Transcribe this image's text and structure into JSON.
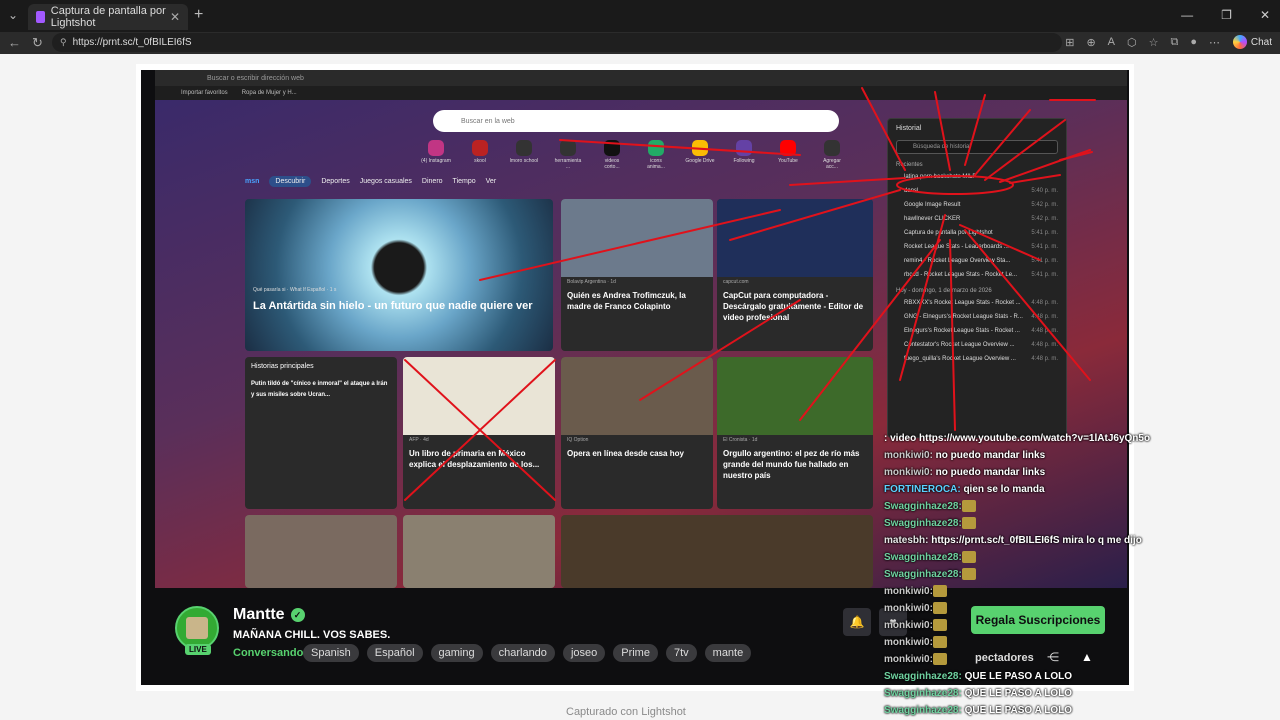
{
  "browser": {
    "tab_title": "Captura de pantalla por Lightshot",
    "url": "https://prnt.sc/t_0fBILEI6fS",
    "copilot_label": "Chat"
  },
  "inner_browser": {
    "address_placeholder": "Buscar o escribir dirección web",
    "favorites": [
      "Importar favoritos",
      "Ropa de Mujer y H..."
    ],
    "search_placeholder": "Buscar en la web",
    "quick_links": [
      "(4) Instagram",
      "skool",
      "lmoro school",
      "herramienta ...",
      "videos corto...",
      "icons anima...",
      "Google Drive",
      "Following",
      "YouTube",
      "Agregar acc..."
    ],
    "msn_nav": [
      "Descubrir",
      "Deportes",
      "Juegos casuales",
      "Dinero",
      "Tiempo",
      "Ver"
    ],
    "hero_source": "Qué pasaría si · What If Español · 1 s",
    "hero_title": "La Antártida sin hielo - un futuro que nadie quiere ver",
    "cards": [
      {
        "source": "Bolavip Argentina · 1d",
        "title": "Quién es Andrea Trofimczuk, la madre de Franco Colapinto"
      },
      {
        "source": "capcut.com",
        "title": "CapCut para computadora - Descárgalo gratuitamente - Editor de video profesional"
      },
      {
        "source": "Historias principales",
        "title": "Putin tildó de \"cínico e inmoral\" el ataque a Irán y sus misiles sobre Ucran..."
      },
      {
        "source": "AFP · 4d",
        "title": "Un libro de primaria en México explica el desplazamiento de los..."
      },
      {
        "source": "IQ Option",
        "title": "Opera en línea desde casa hoy"
      },
      {
        "source": "El Cronista · 1d",
        "title": "Orgullo argentino: el pez de río más grande del mundo fue hallado en nuestro país"
      }
    ],
    "history": {
      "title": "Historial",
      "search_placeholder": "Búsqueda de historial",
      "section_recent": "Recientes",
      "rows": [
        {
          "title": "latina porn backshots MILF",
          "time": ""
        },
        {
          "title": "dansl",
          "time": "5:40 p. m."
        },
        {
          "title": "Google Image Result",
          "time": "5:42 p. m."
        },
        {
          "title": "hawllnever CLICKER",
          "time": "5:42 p. m."
        },
        {
          "title": "Captura de pantalla por Lightshot",
          "time": "5:41 p. m."
        },
        {
          "title": "Rocket League Stats - Leaderboards ...",
          "time": "5:41 p. m."
        },
        {
          "title": "remin4 - Rocket League Overview Sta...",
          "time": "5:41 p. m."
        },
        {
          "title": "rbccd - Rocket League Stats - Rocket Le...",
          "time": "5:41 p. m."
        }
      ],
      "section_today": "Hoy - domingo, 1 de marzo de 2026",
      "rows_today": [
        {
          "title": "RBXXXX's Rocket League Stats - Rocket ...",
          "time": "4:48 p. m."
        },
        {
          "title": "GNG - Elnegurs's Rocket League Stats - R...",
          "time": "4:48 p. m."
        },
        {
          "title": "Elnegurs's Rocket League Stats - Rocket ...",
          "time": "4:48 p. m."
        },
        {
          "title": "Contestator's Rocket League Overview ...",
          "time": "4:48 p. m."
        },
        {
          "title": "fuego_quilla's Rocket League Overview ...",
          "time": "4:48 p. m."
        }
      ]
    }
  },
  "channel": {
    "name": "Mantte",
    "live_badge": "LIVE",
    "stream_title": "MAÑANA CHILL. VOS SABES.",
    "category": "Conversando",
    "tags": [
      "Spanish",
      "Español",
      "gaming",
      "charlando",
      "joseo",
      "Prime",
      "7tv",
      "mante"
    ],
    "subscribe_label": "Regala Suscripciones",
    "viewers_label": "pectadores"
  },
  "chat": [
    {
      "user": "",
      "msg": ": video https://www.youtube.com/watch?v=1lAtJ6yQn5o"
    },
    {
      "user": "monkiwi0:",
      "msg": " no puedo mandar links"
    },
    {
      "user": "monkiwi0:",
      "msg": " no puedo mandar links"
    },
    {
      "user": "FORTINEROCA:",
      "msg": " qien se lo manda"
    },
    {
      "user": "Swagginhaze28:",
      "msg": ""
    },
    {
      "user": "Swagginhaze28:",
      "msg": ""
    },
    {
      "user": "matesbh:",
      "msg": " https://prnt.sc/t_0fBILEI6fS mira lo q me dijo"
    },
    {
      "user": "Swagginhaze28:",
      "msg": ""
    },
    {
      "user": "Swagginhaze28:",
      "msg": ""
    },
    {
      "user": "monkiwi0:",
      "msg": ""
    },
    {
      "user": "monkiwi0:",
      "msg": ""
    },
    {
      "user": "monkiwi0:",
      "msg": ""
    },
    {
      "user": "monkiwi0:",
      "msg": ""
    },
    {
      "user": "monkiwi0:",
      "msg": ""
    },
    {
      "user": "Swagginhaze28:",
      "msg": " QUE LE PASO A LOLO"
    },
    {
      "user": "Swagginhaze28:",
      "msg": " QUE LE PASO A LOLO"
    },
    {
      "user": "Swagginhaze28:",
      "msg": " QUE LE PASO A LOLO"
    }
  ],
  "caption": "Capturado con Lightshot",
  "colors": {
    "accent": "#58d26f",
    "marker": "#e0121b"
  }
}
